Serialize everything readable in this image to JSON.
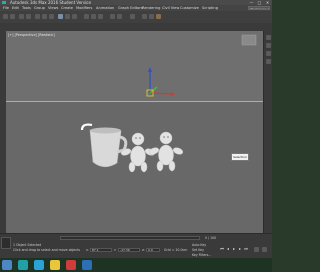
{
  "window": {
    "title": "Autodesk 3ds Max 2016   Student Version",
    "minimize": "—",
    "maximize": "□",
    "close": "✕"
  },
  "menubar": {
    "items": [
      "File",
      "Edit",
      "Tools",
      "Group",
      "Views",
      "Create",
      "Modifiers",
      "Animation",
      "Graph Editors",
      "Rendering",
      "Civil View",
      "Customize",
      "Scripting"
    ],
    "workspace": "Workspace: Default"
  },
  "viewport": {
    "label": "[+] [Perspective] [Realistic]"
  },
  "tooltip": {
    "text": "Selection"
  },
  "status": {
    "selection": "1 Object Selected",
    "prompt": "Click and drag to select and move objects",
    "x_label": "X:",
    "y_label": "Y:",
    "z_label": "Z:",
    "x": "87.1",
    "y": "-17.39",
    "z": "0.0",
    "grid": "Grid = 10.0cm",
    "autokey": "Auto Key",
    "setkey": "Set Key",
    "keyfilters": "Key Filters...",
    "frame": "0 / 100"
  },
  "colors": {
    "horizon": "#86c986",
    "axis_x": "#d23b2b",
    "axis_y": "#49c23b",
    "axis_z": "#2d4fd0",
    "gizmo": "#e8d02a",
    "teapot": "#ffffff",
    "object": "#d9d9d9",
    "viewport_bg": "#6f6f6f",
    "taskbar": "#1f3324"
  },
  "taskbar": {
    "apps": [
      {
        "icon": "windows-icon",
        "color": "#4c87c7"
      },
      {
        "icon": "3dsmax-icon",
        "color": "#22a0a7"
      },
      {
        "icon": "skype-icon",
        "color": "#2aa3d7"
      },
      {
        "icon": "yandex-icon",
        "color": "#e8c83a"
      },
      {
        "icon": "chrome-icon",
        "color": "#cf3c3c"
      },
      {
        "icon": "photoshop-icon",
        "color": "#2c6fb5"
      }
    ]
  }
}
